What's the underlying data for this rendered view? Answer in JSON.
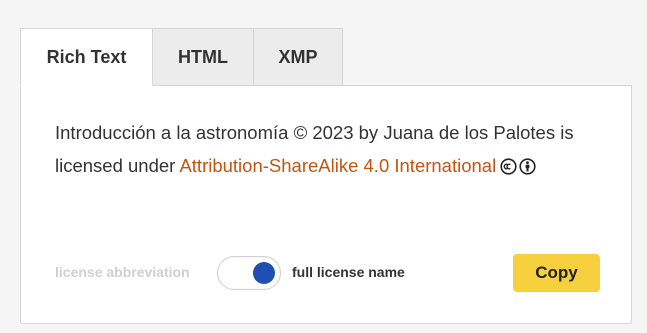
{
  "tabs": [
    {
      "label": "Rich Text",
      "active": true
    },
    {
      "label": "HTML",
      "active": false
    },
    {
      "label": "XMP",
      "active": false
    }
  ],
  "attribution": {
    "prefix": "Introducción a la astronomía © 2023 by Juana de los Palotes is licensed under ",
    "license_link": "Attribution-ShareAlike 4.0 International",
    "icons": [
      "cc-icon",
      "by-icon"
    ]
  },
  "controls": {
    "abbreviation_label": "license abbreviation",
    "full_label": "full license name",
    "toggle_state": "full license name",
    "copy_label": "Copy"
  },
  "colors": {
    "link": "#c45510",
    "toggle_knob": "#1f4fb0",
    "copy_button": "#f6d03d"
  }
}
